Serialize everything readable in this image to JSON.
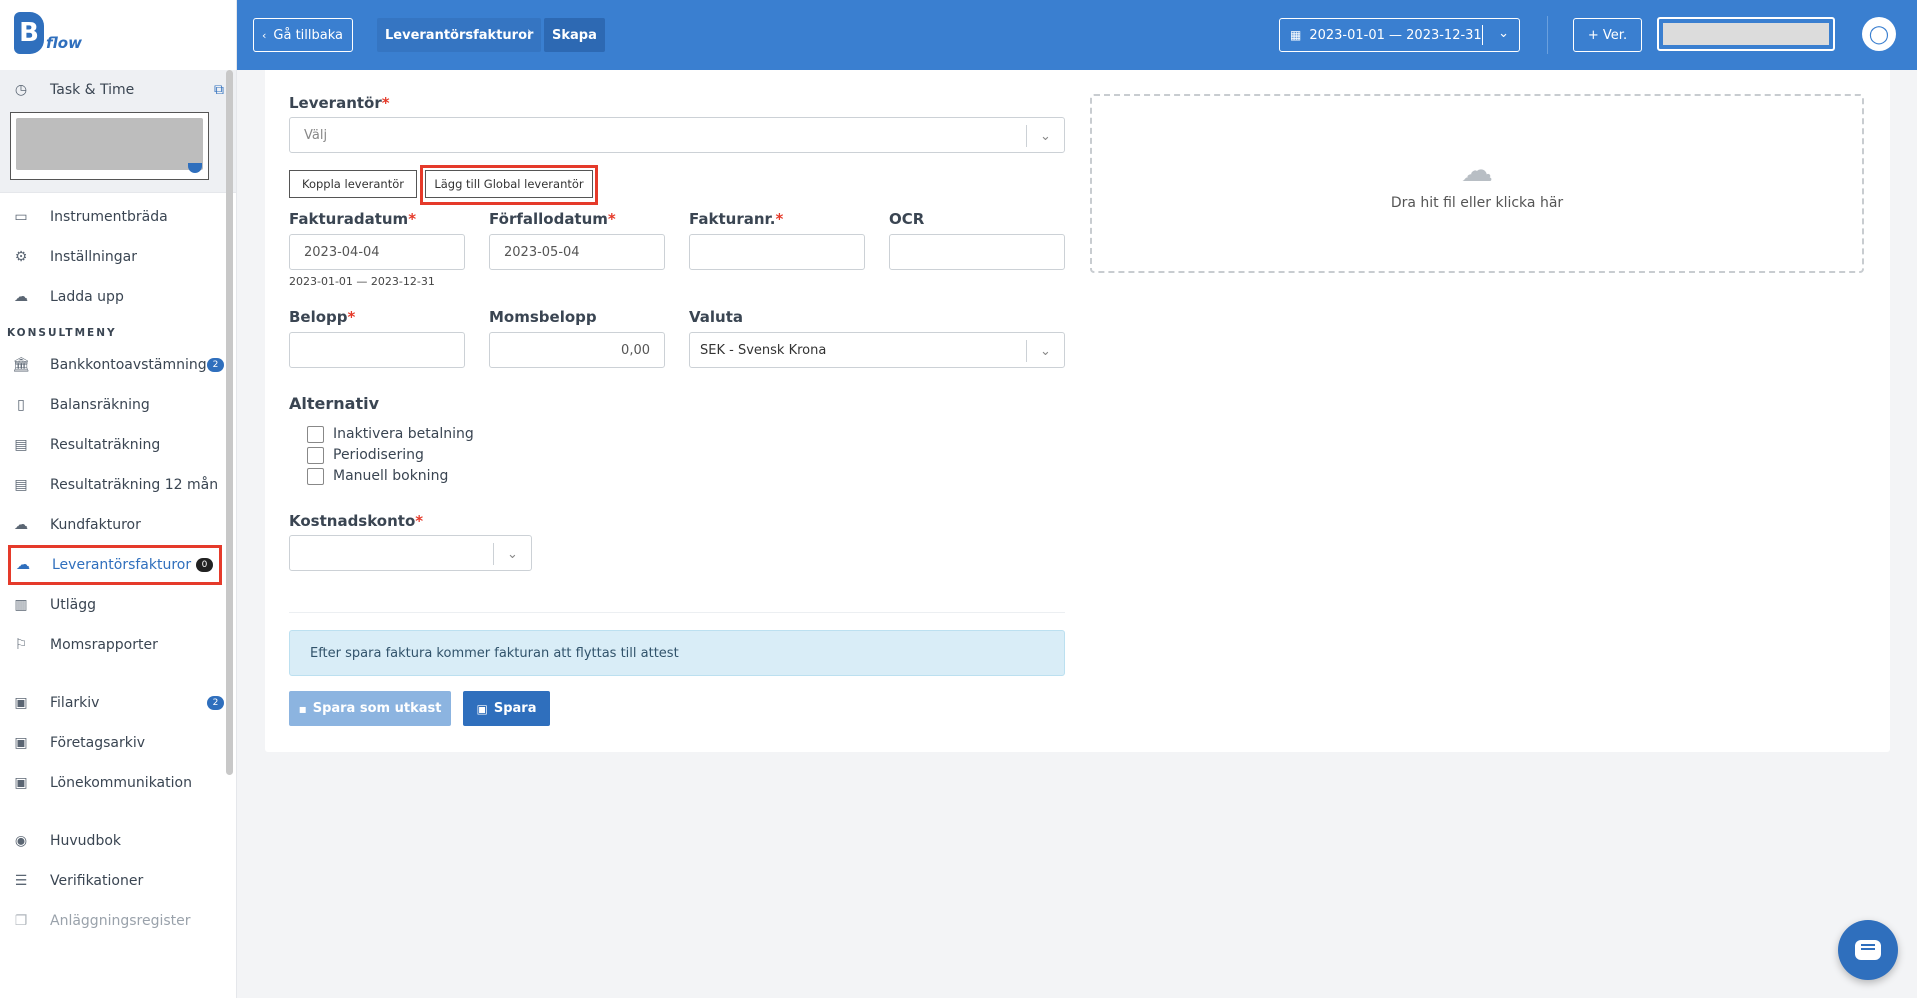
{
  "brand": {
    "logo_letter": "B",
    "logo_text": "flow"
  },
  "sidebar": {
    "top_item": {
      "label": "Task & Time",
      "icon": "clock-icon",
      "ext_icon": "external-link-icon"
    },
    "items_main": [
      {
        "label": "Instrumentbräda",
        "icon": "monitor-icon"
      },
      {
        "label": "Inställningar",
        "icon": "gear-icon"
      },
      {
        "label": "Ladda upp",
        "icon": "cloud-upload-icon"
      }
    ],
    "section_title": "KONSULTMENY",
    "items_consult": [
      {
        "label": "Bankkontoavstämning",
        "icon": "bank-icon",
        "badge": "2"
      },
      {
        "label": "Balansräkning",
        "icon": "book-icon"
      },
      {
        "label": "Resultaträkning",
        "icon": "document-icon"
      },
      {
        "label": "Resultaträkning 12 mån",
        "icon": "document-icon"
      },
      {
        "label": "Kundfakturor",
        "icon": "cloud-upload-icon"
      },
      {
        "label": "Leverantörsfakturor",
        "icon": "cloud-download-icon",
        "badge": "0",
        "active": true
      },
      {
        "label": "Utlägg",
        "icon": "receipt-icon"
      },
      {
        "label": "Momsrapporter",
        "icon": "flag-icon"
      }
    ],
    "items_archive": [
      {
        "label": "Filarkiv",
        "icon": "archive-icon",
        "badge": "2"
      },
      {
        "label": "Företagsarkiv",
        "icon": "archive-icon"
      },
      {
        "label": "Lönekommunikation",
        "icon": "archive-icon"
      }
    ],
    "items_books": [
      {
        "label": "Huvudbok",
        "icon": "eye-icon"
      },
      {
        "label": "Verifikationer",
        "icon": "list-icon"
      },
      {
        "label": "Anläggningsregister",
        "icon": "copy-icon",
        "muted": true
      }
    ]
  },
  "topbar": {
    "back_label": "Gå tillbaka",
    "breadcrumb_1": "Leverantörsfakturor",
    "breadcrumb_sep": "›",
    "breadcrumb_2": "Skapa",
    "date_range": "2023-01-01 — 2023-12-31",
    "ver_label": "+ Ver."
  },
  "form": {
    "supplier_label": "Leverantör",
    "supplier_placeholder": "Välj",
    "link_supplier_btn": "Koppla leverantör",
    "add_global_btn": "Lägg till Global leverantör",
    "invoice_date_label": "Fakturadatum",
    "invoice_date_value": "2023-04-04",
    "invoice_date_hint": "2023-01-01 — 2023-12-31",
    "due_date_label": "Förfallodatum",
    "due_date_value": "2023-05-04",
    "invoice_no_label": "Fakturanr.",
    "invoice_no_value": "",
    "ocr_label": "OCR",
    "ocr_value": "",
    "amount_label": "Belopp",
    "amount_value": "",
    "vat_label": "Momsbelopp",
    "vat_value": "0,00",
    "currency_label": "Valuta",
    "currency_value": "SEK - Svensk Krona",
    "options_title": "Alternativ",
    "options": [
      "Inaktivera betalning",
      "Periodisering",
      "Manuell bokning"
    ],
    "cost_account_label": "Kostnadskonto",
    "info_text": "Efter spara faktura kommer fakturan att flyttas till attest",
    "save_draft_btn": "Spara som utkast",
    "save_btn": "Spara",
    "req_mark": "*"
  },
  "dropzone": {
    "text": "Dra hit fil eller klicka här",
    "icon": "cloud-upload-icon"
  },
  "chat": {
    "icon": "chat-icon"
  },
  "colors": {
    "primary": "#3a7fd0",
    "accent_red": "#e53a2a",
    "info_bg": "#d9edf7"
  }
}
